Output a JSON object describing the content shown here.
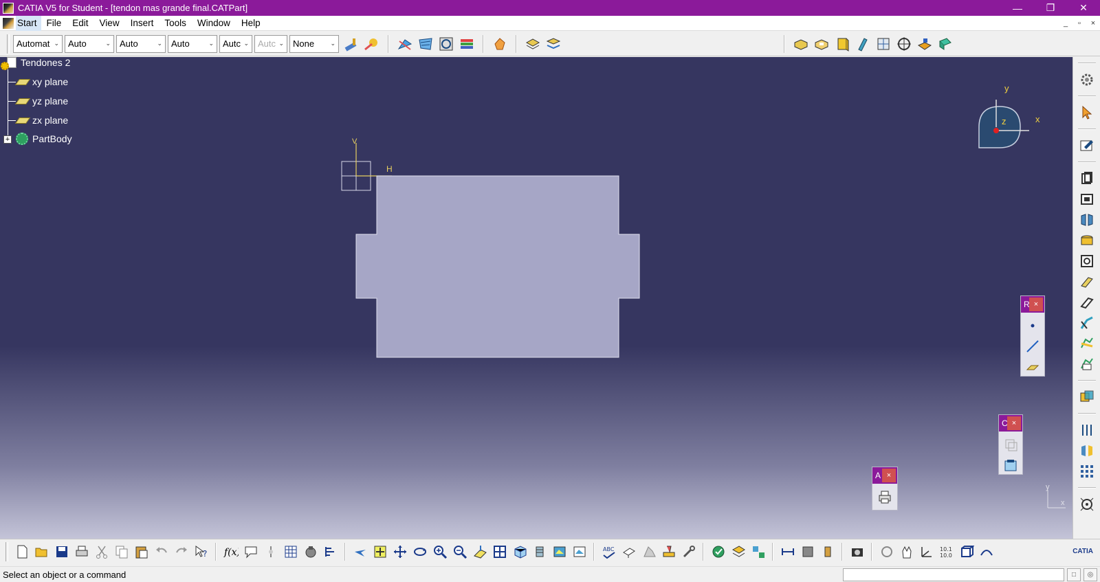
{
  "window": {
    "title": "CATIA V5 for Student - [tendon mas grande final.CATPart]",
    "controls": [
      "minimize",
      "restore",
      "close"
    ]
  },
  "menu": {
    "items": [
      "Start",
      "File",
      "Edit",
      "View",
      "Insert",
      "Tools",
      "Window",
      "Help"
    ],
    "doc_controls": [
      "_",
      "▫",
      "×"
    ]
  },
  "toolbar_top": {
    "combos": [
      {
        "value": "Automat",
        "disabled": false
      },
      {
        "value": "Auto",
        "disabled": false
      },
      {
        "value": "Auto",
        "disabled": false
      },
      {
        "value": "Auto",
        "disabled": false
      },
      {
        "value": "Autc",
        "disabled": false
      },
      {
        "value": "Autc",
        "disabled": true
      },
      {
        "value": "None",
        "disabled": false
      }
    ]
  },
  "tree": {
    "root": "Tendones 2",
    "children": [
      "xy plane",
      "yz plane",
      "zx plane"
    ],
    "body": "PartBody"
  },
  "sketch": {
    "axis_v_label": "V",
    "axis_h_label": "H"
  },
  "compass": {
    "x_label": "x",
    "y_label": "y",
    "z_label": "z"
  },
  "mini_axis": {
    "x_label": "x",
    "y_label": "y"
  },
  "floating_toolbars": {
    "reference": {
      "title": "R",
      "close": "×"
    },
    "constraint": {
      "title": "C",
      "close": "×"
    },
    "analysis": {
      "title": "A",
      "close": "×"
    }
  },
  "status": {
    "message": "Select an object or a command"
  },
  "brand": {
    "logo_text": "CATIA",
    "accent_color": "#8b1a9a",
    "viewport_color": "#363660"
  }
}
